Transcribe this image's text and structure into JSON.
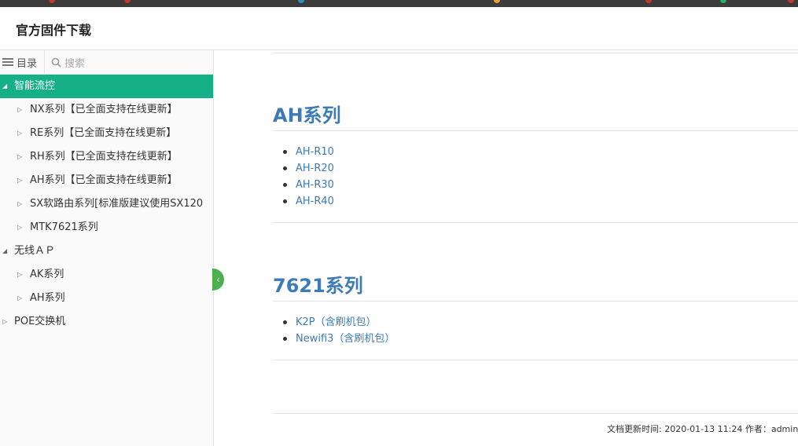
{
  "header": {
    "title": "官方固件下载"
  },
  "sidebar": {
    "toc_label": "目录",
    "search_placeholder": "搜索",
    "tree": [
      {
        "label": "智能流控",
        "active": true
      },
      {
        "label": "NX系列【已全面支持在线更新】"
      },
      {
        "label": "RE系列【已全面支持在线更新】"
      },
      {
        "label": "RH系列【已全面支持在线更新】"
      },
      {
        "label": "AH系列【已全面支持在线更新】"
      },
      {
        "label": "SX软路由系列[标准版建议使用SX120"
      },
      {
        "label": "MTK7621系列"
      },
      {
        "label": "无线ＡＰ"
      },
      {
        "label": "AK系列"
      },
      {
        "label": "AH系列"
      },
      {
        "label": "POE交换机"
      }
    ]
  },
  "content": {
    "sections": [
      {
        "title": "AH系列",
        "links": [
          "AH-R10",
          "AH-R20",
          "AH-R30",
          "AH-R40"
        ]
      },
      {
        "title": "7621系列",
        "links": [
          "K2P（含刷机包）",
          "Newifi3（含刷机包）"
        ]
      }
    ],
    "footer": "文档更新时间: 2020-01-13 11:24   作者：admin"
  },
  "colors": {
    "active": "#16b088",
    "link": "#3d7bb6",
    "toggle": "#4caf50"
  }
}
